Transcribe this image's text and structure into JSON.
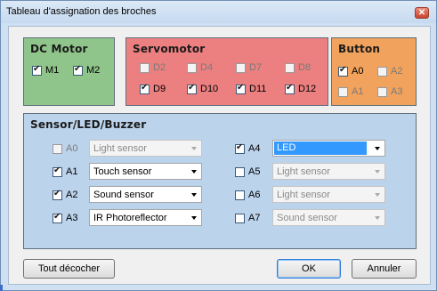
{
  "window": {
    "title": "Tableau d'assignation des broches",
    "close_glyph": "✕"
  },
  "dc_motor": {
    "title": "DC Motor",
    "items": [
      {
        "label": "M1",
        "checked": true,
        "enabled": true
      },
      {
        "label": "M2",
        "checked": true,
        "enabled": true
      }
    ]
  },
  "servomotor": {
    "title": "Servomotor",
    "items": [
      {
        "label": "D2",
        "checked": false,
        "enabled": false
      },
      {
        "label": "D4",
        "checked": false,
        "enabled": false
      },
      {
        "label": "D7",
        "checked": false,
        "enabled": false
      },
      {
        "label": "D8",
        "checked": false,
        "enabled": false
      },
      {
        "label": "D9",
        "checked": true,
        "enabled": true
      },
      {
        "label": "D10",
        "checked": true,
        "enabled": true
      },
      {
        "label": "D11",
        "checked": true,
        "enabled": true
      },
      {
        "label": "D12",
        "checked": true,
        "enabled": true
      }
    ]
  },
  "button": {
    "title": "Button",
    "items": [
      {
        "label": "A0",
        "checked": true,
        "enabled": true
      },
      {
        "label": "A2",
        "checked": false,
        "enabled": false
      },
      {
        "label": "A1",
        "checked": false,
        "enabled": false
      },
      {
        "label": "A3",
        "checked": false,
        "enabled": false
      }
    ]
  },
  "sensors": {
    "title": "Sensor/LED/Buzzer",
    "rows": [
      {
        "pin": "A0",
        "checked": false,
        "enabled": false,
        "value": "Light sensor",
        "combo_enabled": false
      },
      {
        "pin": "A1",
        "checked": true,
        "enabled": true,
        "value": "Touch sensor",
        "combo_enabled": true
      },
      {
        "pin": "A2",
        "checked": true,
        "enabled": true,
        "value": "Sound sensor",
        "combo_enabled": true
      },
      {
        "pin": "A3",
        "checked": true,
        "enabled": true,
        "value": "IR Photoreflector",
        "combo_enabled": true
      },
      {
        "pin": "A4",
        "checked": true,
        "enabled": true,
        "value": "LED",
        "combo_enabled": true,
        "selected": true
      },
      {
        "pin": "A5",
        "checked": false,
        "enabled": true,
        "value": "Light sensor",
        "combo_enabled": false
      },
      {
        "pin": "A6",
        "checked": false,
        "enabled": true,
        "value": "Light sensor",
        "combo_enabled": false
      },
      {
        "pin": "A7",
        "checked": false,
        "enabled": true,
        "value": "Sound sensor",
        "combo_enabled": false
      }
    ]
  },
  "footer": {
    "clear_label": "Tout décocher",
    "ok_label": "OK",
    "cancel_label": "Annuler"
  },
  "colors": {
    "dc_motor_bg": "#8fc48a",
    "servo_bg": "#ec7f7f",
    "button_bg": "#f1a25c",
    "sensor_bg": "#bcd3ec",
    "selection": "#3399ff"
  }
}
